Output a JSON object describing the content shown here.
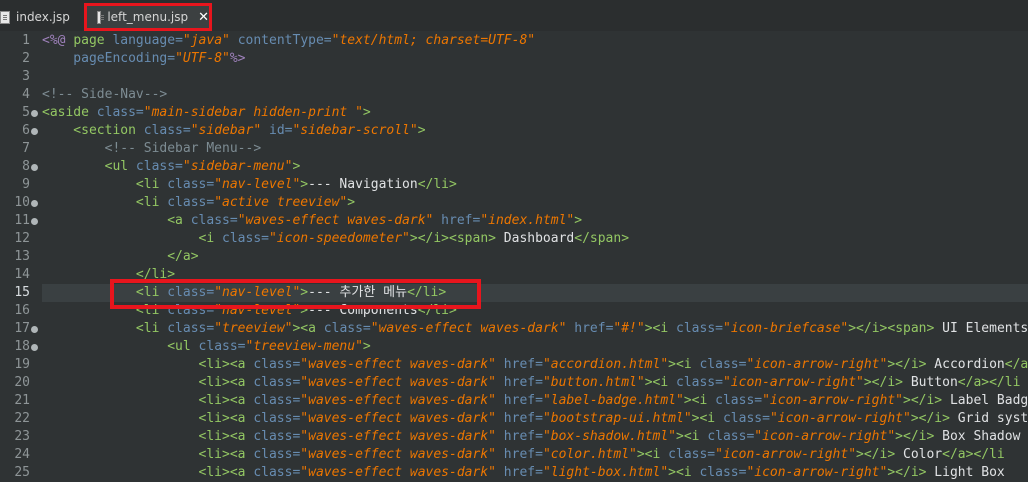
{
  "tabs": [
    {
      "label": "index.jsp",
      "active": false
    },
    {
      "label": "left_menu.jsp",
      "active": true
    }
  ],
  "close_glyph": "✕",
  "current_line": 15,
  "lines": [
    {
      "n": "1",
      "fold": false,
      "segs": [
        [
          "dir",
          "<%@ "
        ],
        [
          "tag",
          "page "
        ],
        [
          "attr",
          "language="
        ],
        [
          "str",
          "\"java\""
        ],
        [
          "attr",
          " contentType="
        ],
        [
          "str",
          "\"text/html; charset=UTF-8\""
        ]
      ]
    },
    {
      "n": "2",
      "fold": false,
      "segs": [
        [
          "attr",
          "    pageEncoding="
        ],
        [
          "str",
          "\"UTF-8\""
        ],
        [
          "dir",
          "%>"
        ]
      ]
    },
    {
      "n": "3",
      "fold": false,
      "segs": []
    },
    {
      "n": "4",
      "fold": false,
      "segs": [
        [
          "c",
          "<!-- Side-Nav-->"
        ]
      ]
    },
    {
      "n": "5",
      "fold": true,
      "segs": [
        [
          "tag",
          "<aside "
        ],
        [
          "attr",
          "class="
        ],
        [
          "str",
          "\"main-sidebar hidden-print \""
        ],
        [
          "tag",
          ">"
        ]
      ]
    },
    {
      "n": "6",
      "fold": true,
      "segs": [
        [
          "tag",
          "    <section "
        ],
        [
          "attr",
          "class="
        ],
        [
          "str",
          "\"sidebar\""
        ],
        [
          "attr",
          " id="
        ],
        [
          "str",
          "\"sidebar-scroll\""
        ],
        [
          "tag",
          ">"
        ]
      ]
    },
    {
      "n": "7",
      "fold": false,
      "segs": [
        [
          "c",
          "        <!-- Sidebar Menu-->"
        ]
      ]
    },
    {
      "n": "8",
      "fold": true,
      "segs": [
        [
          "tag",
          "        <ul "
        ],
        [
          "attr",
          "class="
        ],
        [
          "str",
          "\"sidebar-menu\""
        ],
        [
          "tag",
          ">"
        ]
      ]
    },
    {
      "n": "9",
      "fold": false,
      "segs": [
        [
          "tag",
          "            <li "
        ],
        [
          "attr",
          "class="
        ],
        [
          "str",
          "\"nav-level\""
        ],
        [
          "tag",
          ">"
        ],
        [
          "t",
          "--- Navigation"
        ],
        [
          "tag",
          "</li>"
        ]
      ]
    },
    {
      "n": "10",
      "fold": true,
      "segs": [
        [
          "tag",
          "            <li "
        ],
        [
          "attr",
          "class="
        ],
        [
          "str",
          "\"active treeview\""
        ],
        [
          "tag",
          ">"
        ]
      ]
    },
    {
      "n": "11",
      "fold": true,
      "segs": [
        [
          "tag",
          "                <a "
        ],
        [
          "attr",
          "class="
        ],
        [
          "str",
          "\"waves-effect waves-dark\""
        ],
        [
          "attr",
          " href="
        ],
        [
          "str",
          "\"index.html\""
        ],
        [
          "tag",
          ">"
        ]
      ]
    },
    {
      "n": "12",
      "fold": false,
      "segs": [
        [
          "tag",
          "                    <i "
        ],
        [
          "attr",
          "class="
        ],
        [
          "str",
          "\"icon-speedometer\""
        ],
        [
          "tag",
          "></i><span>"
        ],
        [
          "t",
          " Dashboard"
        ],
        [
          "tag",
          "</span>"
        ]
      ]
    },
    {
      "n": "13",
      "fold": false,
      "segs": [
        [
          "tag",
          "                </a>"
        ]
      ]
    },
    {
      "n": "14",
      "fold": false,
      "segs": [
        [
          "tag",
          "            </li>"
        ]
      ]
    },
    {
      "n": "15",
      "fold": false,
      "segs": [
        [
          "tag",
          "            <li "
        ],
        [
          "attr",
          "class="
        ],
        [
          "str",
          "\"nav-level\""
        ],
        [
          "tag",
          ">"
        ],
        [
          "t",
          "--- 추가한 메뉴"
        ],
        [
          "tag",
          "</li>"
        ]
      ]
    },
    {
      "n": "16",
      "fold": false,
      "segs": [
        [
          "tag",
          "            <li "
        ],
        [
          "attr",
          "class="
        ],
        [
          "str",
          "\"nav-level\""
        ],
        [
          "tag",
          ">"
        ],
        [
          "t",
          "--- Components"
        ],
        [
          "tag",
          "</li>"
        ]
      ]
    },
    {
      "n": "17",
      "fold": true,
      "segs": [
        [
          "tag",
          "            <li "
        ],
        [
          "attr",
          "class="
        ],
        [
          "str",
          "\"treeview\""
        ],
        [
          "tag",
          "><a "
        ],
        [
          "attr",
          "class="
        ],
        [
          "str",
          "\"waves-effect waves-dark\""
        ],
        [
          "attr",
          " href="
        ],
        [
          "str",
          "\"#!\""
        ],
        [
          "tag",
          "><i "
        ],
        [
          "attr",
          "class="
        ],
        [
          "str",
          "\"icon-briefcase\""
        ],
        [
          "tag",
          "></i><span>"
        ],
        [
          "t",
          " UI Elements"
        ]
      ]
    },
    {
      "n": "18",
      "fold": true,
      "segs": [
        [
          "tag",
          "                <ul "
        ],
        [
          "attr",
          "class="
        ],
        [
          "str",
          "\"treeview-menu\""
        ],
        [
          "tag",
          ">"
        ]
      ]
    },
    {
      "n": "19",
      "fold": false,
      "segs": [
        [
          "tag",
          "                    <li><a "
        ],
        [
          "attr",
          "class="
        ],
        [
          "str",
          "\"waves-effect waves-dark\""
        ],
        [
          "attr",
          " href="
        ],
        [
          "str",
          "\"accordion.html\""
        ],
        [
          "tag",
          "><i "
        ],
        [
          "attr",
          "class="
        ],
        [
          "str",
          "\"icon-arrow-right\""
        ],
        [
          "tag",
          "></i>"
        ],
        [
          "t",
          " Accordion"
        ],
        [
          "tag",
          "</a"
        ]
      ]
    },
    {
      "n": "20",
      "fold": false,
      "segs": [
        [
          "tag",
          "                    <li><a "
        ],
        [
          "attr",
          "class="
        ],
        [
          "str",
          "\"waves-effect waves-dark\""
        ],
        [
          "attr",
          " href="
        ],
        [
          "str",
          "\"button.html\""
        ],
        [
          "tag",
          "><i "
        ],
        [
          "attr",
          "class="
        ],
        [
          "str",
          "\"icon-arrow-right\""
        ],
        [
          "tag",
          "></i>"
        ],
        [
          "t",
          " Button"
        ],
        [
          "tag",
          "</a></li"
        ]
      ]
    },
    {
      "n": "21",
      "fold": false,
      "segs": [
        [
          "tag",
          "                    <li><a "
        ],
        [
          "attr",
          "class="
        ],
        [
          "str",
          "\"waves-effect waves-dark\""
        ],
        [
          "attr",
          " href="
        ],
        [
          "str",
          "\"label-badge.html\""
        ],
        [
          "tag",
          "><i "
        ],
        [
          "attr",
          "class="
        ],
        [
          "str",
          "\"icon-arrow-right\""
        ],
        [
          "tag",
          "></i>"
        ],
        [
          "t",
          " Label Badg"
        ]
      ]
    },
    {
      "n": "22",
      "fold": false,
      "segs": [
        [
          "tag",
          "                    <li><a "
        ],
        [
          "attr",
          "class="
        ],
        [
          "str",
          "\"waves-effect waves-dark\""
        ],
        [
          "attr",
          " href="
        ],
        [
          "str",
          "\"bootstrap-ui.html\""
        ],
        [
          "tag",
          "><i "
        ],
        [
          "attr",
          "class="
        ],
        [
          "str",
          "\"icon-arrow-right\""
        ],
        [
          "tag",
          "></i>"
        ],
        [
          "t",
          " Grid syst"
        ]
      ]
    },
    {
      "n": "23",
      "fold": false,
      "segs": [
        [
          "tag",
          "                    <li><a "
        ],
        [
          "attr",
          "class="
        ],
        [
          "str",
          "\"waves-effect waves-dark\""
        ],
        [
          "attr",
          " href="
        ],
        [
          "str",
          "\"box-shadow.html\""
        ],
        [
          "tag",
          "><i "
        ],
        [
          "attr",
          "class="
        ],
        [
          "str",
          "\"icon-arrow-right\""
        ],
        [
          "tag",
          "></i>"
        ],
        [
          "t",
          " Box Shadow"
        ]
      ]
    },
    {
      "n": "24",
      "fold": false,
      "segs": [
        [
          "tag",
          "                    <li><a "
        ],
        [
          "attr",
          "class="
        ],
        [
          "str",
          "\"waves-effect waves-dark\""
        ],
        [
          "attr",
          " href="
        ],
        [
          "str",
          "\"color.html\""
        ],
        [
          "tag",
          "><i "
        ],
        [
          "attr",
          "class="
        ],
        [
          "str",
          "\"icon-arrow-right\""
        ],
        [
          "tag",
          "></i>"
        ],
        [
          "t",
          " Color"
        ],
        [
          "tag",
          "</a></li"
        ]
      ]
    },
    {
      "n": "25",
      "fold": false,
      "segs": [
        [
          "tag",
          "                    <li><a "
        ],
        [
          "attr",
          "class="
        ],
        [
          "str",
          "\"waves-effect waves-dark\""
        ],
        [
          "attr",
          " href="
        ],
        [
          "str",
          "\"light-box.html\""
        ],
        [
          "tag",
          "><i "
        ],
        [
          "attr",
          "class="
        ],
        [
          "str",
          "\"icon-arrow-right\""
        ],
        [
          "tag",
          "></i>"
        ],
        [
          "t",
          " Light Box"
        ]
      ]
    }
  ]
}
